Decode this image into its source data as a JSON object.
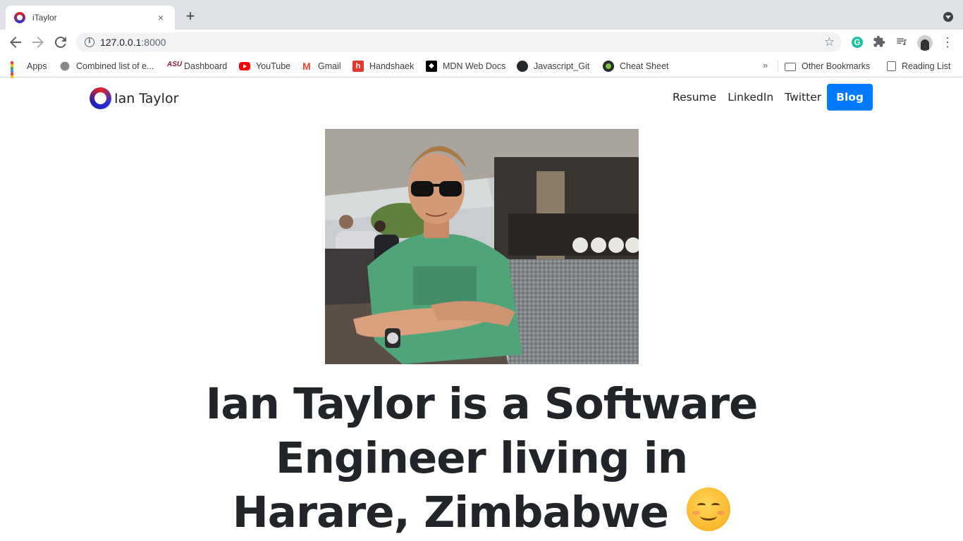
{
  "browser": {
    "tab": {
      "title": "iTaylor",
      "close": "×"
    },
    "new_tab": "+",
    "url_host": "127.0.0.1",
    "url_port": ":8000",
    "bookmarks": [
      {
        "label": "Apps",
        "icon": "apps-grid-icon"
      },
      {
        "label": "Combined list of e...",
        "icon": "bookmark-favicon-icon"
      },
      {
        "label": "Dashboard",
        "icon": "asu-icon"
      },
      {
        "label": "YouTube",
        "icon": "youtube-icon"
      },
      {
        "label": "Gmail",
        "icon": "gmail-icon"
      },
      {
        "label": "Handshaek",
        "icon": "handshake-icon"
      },
      {
        "label": "MDN Web Docs",
        "icon": "mdn-icon"
      },
      {
        "label": "Javascript_Git",
        "icon": "github-icon"
      },
      {
        "label": "Cheat Sheet",
        "icon": "cheat-sheet-icon"
      }
    ],
    "bookmarks_more": "»",
    "other_bookmarks": "Other Bookmarks",
    "reading_list": "Reading List"
  },
  "site": {
    "brand": "Ian Taylor",
    "nav": {
      "resume": "Resume",
      "linkedin": "LinkedIn",
      "twitter": "Twitter",
      "blog": "Blog"
    },
    "headline": "Ian Taylor is a Software Engineer living in Harare, Zimbabwe"
  },
  "colors": {
    "blog_button": "#007bff",
    "text": "#212529",
    "tabstrip": "#dee1e6"
  }
}
